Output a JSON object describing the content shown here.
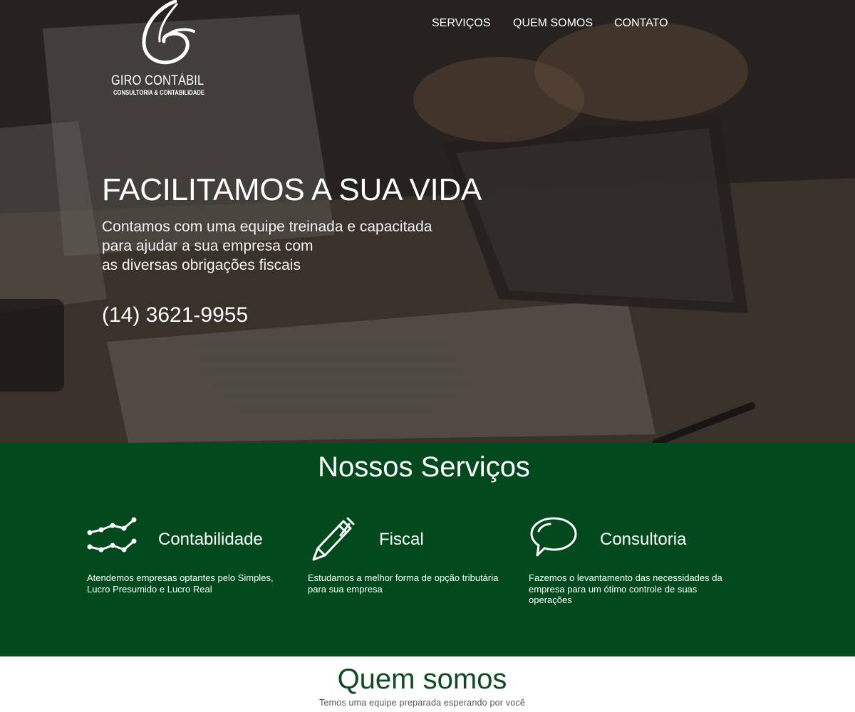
{
  "brand": {
    "name": "GIRO CONTÁBIL",
    "tagline": "CONSULTORIA & CONTABILIDADE",
    "logo_icon": "stylized-g-logo"
  },
  "nav": {
    "items": [
      "SERVIÇOS",
      "QUEM SOMOS",
      "CONTATO"
    ]
  },
  "hero": {
    "headline": "FACILITAMOS A SUA VIDA",
    "lead_lines": [
      "Contamos com uma equipe treinada e capacitada",
      "para ajudar a sua empresa com",
      "as diversas obrigações fiscais"
    ],
    "phone": "(14) 3621-9955"
  },
  "services": {
    "title": "Nossos Serviços",
    "background": "#02491e",
    "items": [
      {
        "icon": "line-chart-icon",
        "label": "Contabilidade",
        "desc": "Atendemos empresas optantes pelo Simples, Lucro Presumido e Lucro Real"
      },
      {
        "icon": "pen-icon",
        "label": "Fiscal",
        "desc": "Estudamos a melhor forma de opção tributária para sua empresa"
      },
      {
        "icon": "speech-bubble-icon",
        "label": "Consultoria",
        "desc": "Fazemos o levantamento das necessidades da empresa para um ótimo controle de suas operações"
      }
    ]
  },
  "about": {
    "title": "Quem somos",
    "subtitle": "Temos uma equipe preparada esperando por você",
    "title_color": "#0f4a22"
  }
}
